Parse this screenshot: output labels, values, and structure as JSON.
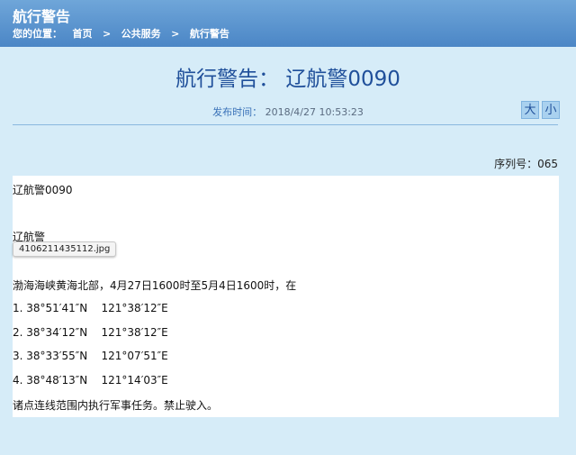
{
  "header": {
    "title": "航行警告",
    "breadcrumb": "您的位置：   首页   >   公共服务   >   航行警告"
  },
  "article": {
    "title": "航行警告：  辽航警0090",
    "pubtime_label": "发布时间：",
    "pubtime_value": "2018/4/27 10:53:23",
    "font_large": "大",
    "font_small": "小",
    "serial": "序列号：065",
    "lines": [
      "辽航警0090",
      "辽航警",
      "渤海海峡黄海北部，4月27日1600时至5月4日1600时，在",
      "1. 38°51′41″N    121°38′12″E",
      "2. 38°34′12″N    121°38′12″E",
      "3. 38°33′55″N    121°07′51″E",
      "4. 38°48′13″N    121°14′03″E",
      "诸点连线范围内执行军事任务。禁止驶入。"
    ],
    "image_tooltip": "4106211435112.jpg"
  }
}
